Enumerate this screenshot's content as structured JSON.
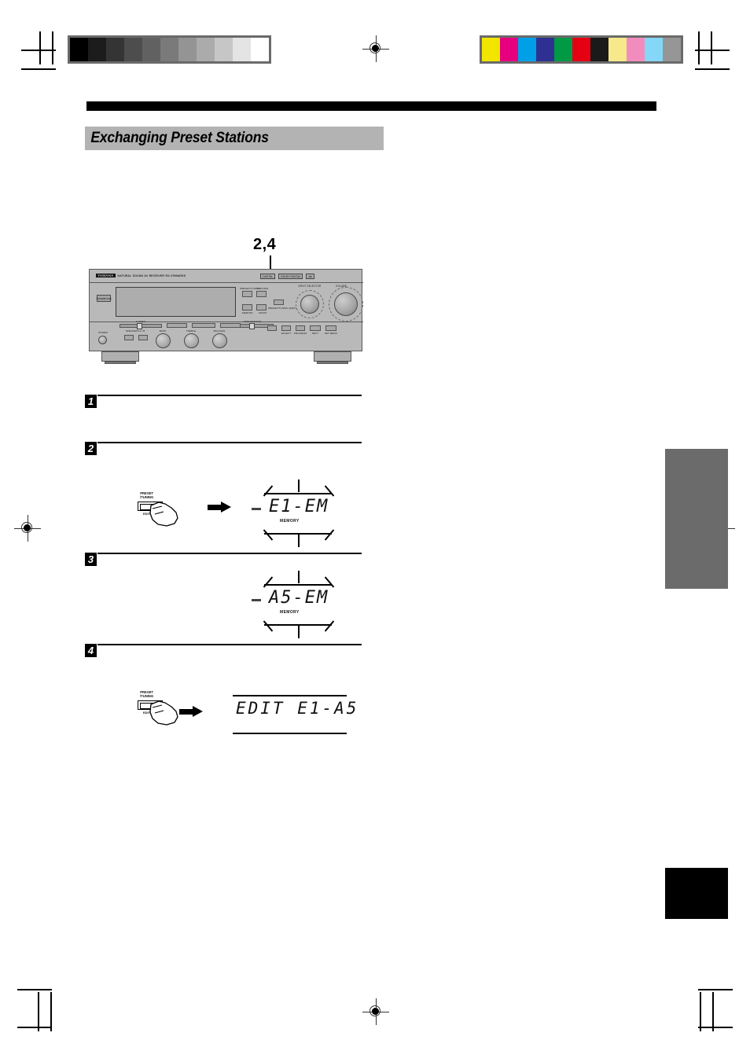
{
  "page": {
    "section_title": "Exchanging Preset Stations",
    "callout": "2,4"
  },
  "print_marks": {
    "gray_wedge": {
      "name": "grayscale-step-wedge",
      "steps": [
        "#000000",
        "#1c1c1c",
        "#343434",
        "#4d4d4d",
        "#616161",
        "#7a7a7a",
        "#949494",
        "#ababab",
        "#c6c6c6",
        "#e4e4e4",
        "#ffffff"
      ]
    },
    "color_bar": {
      "name": "process-color-bar",
      "swatches": [
        "#f2e500",
        "#e6007e",
        "#00a0e9",
        "#2e3192",
        "#009944",
        "#e50012",
        "#1a1a1a",
        "#f7e98b",
        "#f38cbe",
        "#85d7f7",
        "#969696"
      ]
    },
    "registration_marks": 4
  },
  "device": {
    "name": "yamaha-av-receiver-front-panel",
    "brand": "YAMAHA",
    "brand_sub": "NATURAL SOUND AV RECEIVER",
    "model": "RX-V595aRDS",
    "badges": [
      "DIGITAL",
      "DOLBY DIGITAL",
      "dts"
    ],
    "standby_button": "STANDBY/ON",
    "knobs": [
      {
        "label": "INPUT SELECTOR",
        "name": "input-selector-knob"
      },
      {
        "label": "VOLUME",
        "name": "volume-knob"
      }
    ],
    "front_controls": [
      {
        "label": "POWER",
        "name": "power-button"
      },
      {
        "label": "SPEAKERS A / B",
        "name": "speakers-ab-buttons"
      },
      {
        "label": "BASS",
        "name": "bass-knob"
      },
      {
        "label": "TREBLE",
        "name": "treble-knob"
      },
      {
        "label": "BALANCE",
        "name": "balance-knob"
      }
    ],
    "sliders": [
      {
        "label": "S VIDEO",
        "name": "s-video-slider"
      },
      {
        "label": "TAPE MONITOR",
        "name": "tape-monitor-slider"
      }
    ],
    "display_buttons": [
      {
        "label": "PRESET/TUNING",
        "name": "preset-tuning-up-button"
      },
      {
        "label": "A/B/C/D/E",
        "name": "abcde-button"
      },
      {
        "label": "MEMORY",
        "name": "memory-button"
      },
      {
        "label": "FM/AM",
        "name": "fm-am-button"
      }
    ],
    "edit_button": {
      "label": "PRESET/TUNING (EDIT)",
      "name": "preset-tuning-edit-button"
    },
    "bottom_buttons": [
      {
        "label": "EFFECT",
        "name": "effect-button"
      },
      {
        "label": "PROGRAM",
        "name": "program-button"
      },
      {
        "label": "NEXT",
        "name": "next-button"
      },
      {
        "label": "SET MENU",
        "name": "set-menu-button"
      },
      {
        "label": "TIME/LEVEL",
        "name": "time-level-button"
      }
    ]
  },
  "steps": [
    {
      "number": "1",
      "name": "step-1"
    },
    {
      "number": "2",
      "name": "step-2"
    },
    {
      "number": "3",
      "name": "step-3"
    },
    {
      "number": "4",
      "name": "step-4"
    }
  ],
  "figures": {
    "step2": {
      "button_label_line1": "PRESET",
      "button_label_line2": "/TUNING",
      "button_sub": "EDIT",
      "display_text": "E1-EM",
      "display_memory": "MEMORY",
      "flashing": true
    },
    "step3": {
      "display_text": "A5-EM",
      "display_memory": "MEMORY",
      "flashing": true
    },
    "step4": {
      "button_label_line1": "PRESET",
      "button_label_line2": "/TUNING",
      "button_sub": "EDIT",
      "display_text": "EDIT E1-A5",
      "flashing": false
    }
  }
}
